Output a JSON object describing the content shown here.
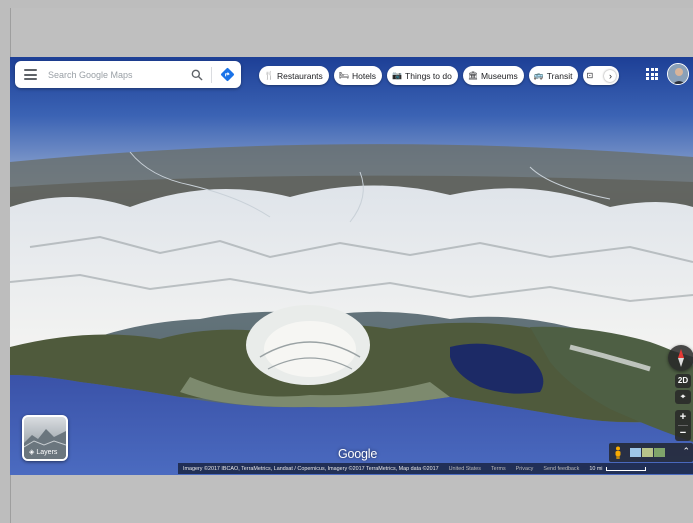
{
  "search": {
    "placeholder": "Search Google Maps"
  },
  "chips": [
    {
      "label": "Restaurants",
      "icon": "restaurant-icon",
      "glyph": "🍴"
    },
    {
      "label": "Hotels",
      "icon": "hotel-icon",
      "glyph": "🛏"
    },
    {
      "label": "Things to do",
      "icon": "camera-icon",
      "glyph": "📷"
    },
    {
      "label": "Museums",
      "icon": "museum-icon",
      "glyph": "🏛"
    },
    {
      "label": "Transit",
      "icon": "transit-icon",
      "glyph": "🚌"
    }
  ],
  "layers": {
    "label": "Layers"
  },
  "logo": "Google",
  "attribution": {
    "imagery": "Imagery ©2017 IBCAO, TerraMetrics, Landsat / Copernicus, Imagery ©2017 TerraMetrics, Map data ©2017",
    "country": "United States",
    "terms": "Terms",
    "privacy": "Privacy",
    "feedback": "Send feedback",
    "scale": "10 mi"
  },
  "controls": {
    "view_toggle": "2D",
    "zoom_in": "+",
    "zoom_out": "−",
    "expand": "⌃"
  },
  "colors": {
    "accent_blue": "#1a73e8",
    "ocean": "#3b63b4",
    "snow": "#f2f2ef"
  }
}
